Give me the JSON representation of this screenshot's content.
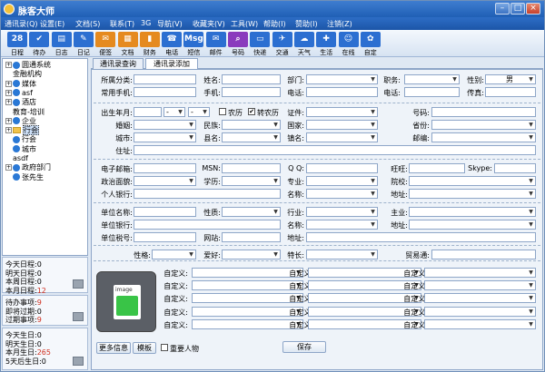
{
  "window": {
    "title": "脉客大师",
    "minimize": "–",
    "restore": "□",
    "close": "×"
  },
  "menu": [
    "通讯录(Q)",
    "设置(E)",
    "文档(S)",
    "联系(T)",
    "3G",
    "导航(V)",
    "收藏夹(V)",
    "工具(W)",
    "帮助(I)",
    "赞助(I)",
    "注销(Z)"
  ],
  "toolbar": [
    {
      "label": "日程",
      "icon": "28",
      "color": "#2c6fd1"
    },
    {
      "label": "待办",
      "icon": "✔",
      "color": "#2c6fd1"
    },
    {
      "label": "日志",
      "icon": "▤",
      "color": "#2c6fd1"
    },
    {
      "label": "日记",
      "icon": "✎",
      "color": "#2c6fd1"
    },
    {
      "label": "便签",
      "icon": "✉",
      "color": "#e58a1f"
    },
    {
      "label": "文档",
      "icon": "▦",
      "color": "#e58a1f"
    },
    {
      "label": "财务",
      "icon": "▮",
      "color": "#e58a1f"
    },
    {
      "label": "电话",
      "icon": "☎",
      "color": "#2c6fd1"
    },
    {
      "label": "短信",
      "icon": "Msg",
      "color": "#2c6fd1"
    },
    {
      "label": "邮件",
      "icon": "✉",
      "color": "#2c6fd1"
    },
    {
      "label": "号码",
      "icon": "⌕",
      "color": "#8a3bbd"
    },
    {
      "label": "快递",
      "icon": "▭",
      "color": "#2c6fd1"
    },
    {
      "label": "交通",
      "icon": "✈",
      "color": "#2c6fd1"
    },
    {
      "label": "天气",
      "icon": "☁",
      "color": "#2c6fd1"
    },
    {
      "label": "生活",
      "icon": "✚",
      "color": "#2c6fd1"
    },
    {
      "label": "在线",
      "icon": "☺",
      "color": "#2c6fd1"
    },
    {
      "label": "自定",
      "icon": "✿",
      "color": "#2c6fd1"
    }
  ],
  "tree": [
    {
      "text": "圆通系统",
      "exp": "+",
      "type": "person"
    },
    {
      "text": "金融机构",
      "exp": "",
      "type": "none"
    },
    {
      "text": "媒体",
      "exp": "+",
      "type": "person"
    },
    {
      "text": "asf",
      "exp": "+",
      "type": "person"
    },
    {
      "text": "酒店",
      "exp": "+",
      "type": "person"
    },
    {
      "text": "教育-培训",
      "exp": "",
      "type": "none"
    },
    {
      "text": "企业",
      "exp": "+",
      "type": "person"
    },
    {
      "text": "行会",
      "exp": "+",
      "type": "folder",
      "selected": true
    },
    {
      "text": "行会",
      "exp": "",
      "type": "person"
    },
    {
      "text": "城市",
      "exp": "",
      "type": "person"
    },
    {
      "text": "asdf",
      "exp": "",
      "type": "none"
    },
    {
      "text": "政府部门",
      "exp": "+",
      "type": "person"
    },
    {
      "text": "张先生",
      "exp": "",
      "type": "person"
    }
  ],
  "schedule": [
    {
      "label": "今天日程:",
      "value": "0"
    },
    {
      "label": "明天日程:",
      "value": "0"
    },
    {
      "label": "本周日程:",
      "value": "0"
    },
    {
      "label": "本月日程:",
      "value": "12"
    }
  ],
  "todo": [
    {
      "label": "待办事项:",
      "value": "9"
    },
    {
      "label": "即将过期:",
      "value": "0"
    },
    {
      "label": "过期事项:",
      "value": "9"
    }
  ],
  "birthdays": [
    {
      "label": "今天生日:",
      "value": "0"
    },
    {
      "label": "明天生日:",
      "value": "0"
    },
    {
      "label": "本月生日:",
      "value": "265"
    },
    {
      "label": "5天后生日:",
      "value": "0"
    }
  ],
  "tabs": [
    "通讯录查询",
    "通讯录添加"
  ],
  "form": {
    "category": "所属分类:",
    "name": "姓名:",
    "dept": "部门:",
    "position": "职务:",
    "gender": "性别:",
    "gender_value": "男",
    "phone": "常用手机:",
    "mobile": "手机:",
    "tel": "电话:",
    "tel2": "电话:",
    "fax": "传真:",
    "birth": "出生年月:",
    "birth_y": "",
    "birth_m": "-",
    "birth_d": "-",
    "agri": "农历",
    "nonagri": "转农历",
    "cert": "证件:",
    "number": "号码:",
    "marriage": "婚姻:",
    "ethnic": "民族:",
    "country": "国家:",
    "province": "省份:",
    "city": "城市:",
    "county": "县名:",
    "town": "镇名:",
    "zip": "邮编:",
    "address": "住址:",
    "email": "电子邮箱:",
    "msn": "MSN:",
    "qq": "Q  Q:",
    "wangwang": "旺旺:",
    "skype": "Skype:",
    "politics": "政治面貌:",
    "education": "学历:",
    "major": "专业:",
    "school": "院校:",
    "bank": "个人银行:",
    "bank_name": "名称:",
    "bank_addr": "地址:",
    "company": "单位名称:",
    "nature": "性质:",
    "industry": "行业:",
    "business": "主业:",
    "cbank": "单位银行:",
    "cbank_name": "名称:",
    "cbank_addr": "地址:",
    "tax": "单位税号:",
    "website": "网站:",
    "caddress": "地址:",
    "character": "性格:",
    "hobby": "爱好:",
    "specialty": "特长:",
    "trade": "贸易通:",
    "custom": "自定义:",
    "photo_tag": "image"
  },
  "buttons": {
    "more": "更多信息",
    "template": "模板",
    "important": "重要人物",
    "save": "保存"
  }
}
